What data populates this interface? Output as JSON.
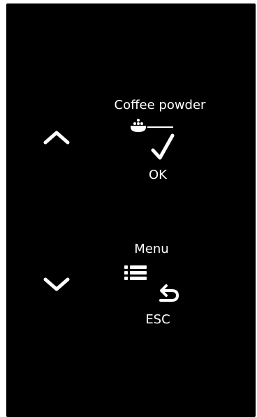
{
  "screen": {
    "background": "#000000",
    "foreground": "#ffffff"
  },
  "nav": {
    "up_icon": "chevron-up-icon",
    "down_icon": "chevron-down-icon"
  },
  "coffee_action": {
    "title": "Coffee powder",
    "icon": "coffee-powder-icon",
    "confirm_icon": "checkmark-icon",
    "confirm_label": "OK"
  },
  "menu_action": {
    "title": "Menu",
    "icon": "menu-list-icon",
    "back_icon": "return-arrow-icon",
    "back_label": "ESC"
  }
}
